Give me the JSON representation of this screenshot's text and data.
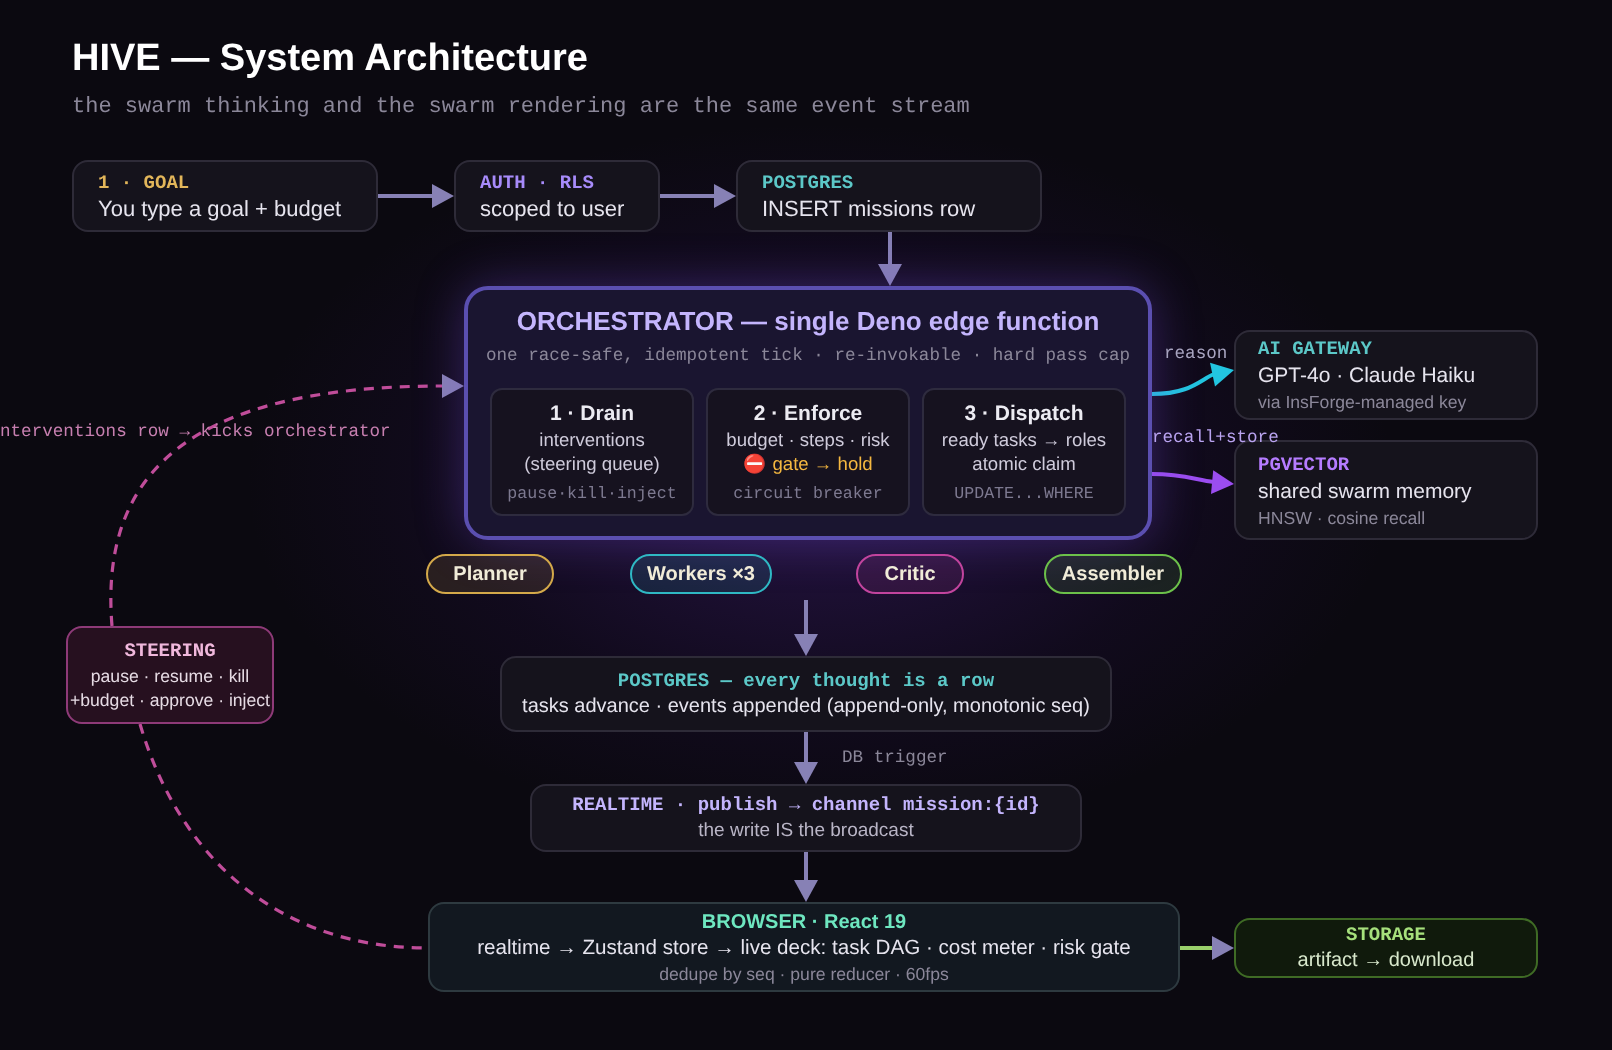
{
  "header": {
    "title": "HIVE — System Architecture",
    "subtitle": "the swarm thinking and the swarm rendering are the same event stream"
  },
  "top_nodes": [
    {
      "label": "1 · GOAL",
      "color": "#e2b65a",
      "text": "You type a goal + budget"
    },
    {
      "label": "AUTH · RLS",
      "color": "#a78bfa",
      "text": "scoped to user"
    },
    {
      "label": "POSTGRES",
      "color": "#5cc8c8",
      "text": "INSERT missions row"
    }
  ],
  "orchestrator": {
    "title": "ORCHESTRATOR — single Deno edge function",
    "subtitle": "one race-safe, idempotent tick · re-invokable · hard pass cap",
    "stages": [
      {
        "title": "1 · Drain",
        "lines": [
          {
            "kind": "plain",
            "text": "interventions"
          },
          {
            "kind": "plain",
            "text": "(steering queue)"
          }
        ],
        "note": "pause·kill·inject"
      },
      {
        "title": "2 · Enforce",
        "lines": [
          {
            "kind": "plain",
            "text": "budget · steps · risk"
          },
          {
            "kind": "alert",
            "text": "⛔ gate → hold"
          }
        ],
        "note": "circuit breaker"
      },
      {
        "title": "3 · Dispatch",
        "lines": [
          {
            "kind": "plain",
            "text": "ready tasks → roles"
          },
          {
            "kind": "plain",
            "text": "atomic claim"
          }
        ],
        "note": "UPDATE...WHERE"
      }
    ]
  },
  "roles": [
    {
      "label": "Planner",
      "color": "#d4a94a"
    },
    {
      "label": "Workers ×3",
      "color": "#2fb8c4"
    },
    {
      "label": "Critic",
      "color": "#c2449e"
    },
    {
      "label": "Assembler",
      "color": "#6cc04a"
    }
  ],
  "side_nodes": [
    {
      "label": "AI GATEWAY",
      "color": "#5cc8c8",
      "text": "GPT-4o · Claude Haiku",
      "note": "via InsForge-managed key"
    },
    {
      "label": "PGVECTOR",
      "color": "#b57cff",
      "text": "shared swarm memory",
      "note": "HNSW · cosine recall"
    }
  ],
  "steering": {
    "label": "STEERING",
    "lines": [
      "pause · resume · kill",
      "+budget · approve · inject"
    ]
  },
  "flow_nodes": [
    {
      "label": "POSTGRES — every thought is a row",
      "color": "#5cc8c8",
      "text": "tasks advance · events appended (append-only, monotonic seq)"
    },
    {
      "label": "REALTIME · publish → channel mission:{id}",
      "color": "#c4b5fd",
      "text": "the write IS the broadcast"
    }
  ],
  "browser": {
    "label": "BROWSER · React 19",
    "text": "realtime → Zustand store → live deck: task DAG · cost meter · risk gate",
    "note": "dedupe by seq · pure reducer · 60fps"
  },
  "storage": {
    "label": "STORAGE",
    "text": "artifact → download"
  },
  "edge_labels": [
    {
      "text": "nterventions row → kicks orchestrator"
    },
    {
      "text": "reason"
    },
    {
      "text": "recall+store"
    },
    {
      "text": "DB trigger"
    }
  ]
}
